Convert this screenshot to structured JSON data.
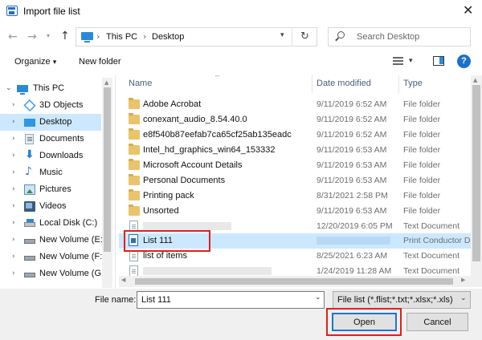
{
  "window": {
    "title": "Import file list"
  },
  "navigation": {
    "breadcrumb": [
      "This PC",
      "Desktop"
    ],
    "search_placeholder": "Search Desktop"
  },
  "toolbar": {
    "organize": "Organize",
    "new_folder": "New folder",
    "help": "?"
  },
  "sidebar": {
    "items": [
      {
        "label": "This PC",
        "icon": "computer-icon",
        "selected": false
      },
      {
        "label": "3D Objects",
        "icon": "cube-icon",
        "selected": false
      },
      {
        "label": "Desktop",
        "icon": "desktop-icon",
        "selected": true
      },
      {
        "label": "Documents",
        "icon": "document-icon",
        "selected": false
      },
      {
        "label": "Downloads",
        "icon": "download-icon",
        "selected": false
      },
      {
        "label": "Music",
        "icon": "music-icon",
        "selected": false
      },
      {
        "label": "Pictures",
        "icon": "picture-icon",
        "selected": false
      },
      {
        "label": "Videos",
        "icon": "video-icon",
        "selected": false
      },
      {
        "label": "Local Disk (C:)",
        "icon": "drive-icon",
        "selected": false
      },
      {
        "label": "New Volume (E:)",
        "icon": "drive-icon",
        "selected": false
      },
      {
        "label": "New Volume (F:)",
        "icon": "drive-icon",
        "selected": false
      },
      {
        "label": "New Volume (G:",
        "icon": "drive-icon",
        "selected": false
      }
    ]
  },
  "filelist": {
    "columns": [
      "Name",
      "Date modified",
      "Type"
    ],
    "rows": [
      {
        "name": "Adobe Acrobat",
        "date": "9/11/2019 6:52 AM",
        "type": "File folder",
        "icon": "folder-icon"
      },
      {
        "name": "conexant_audio_8.54.40.0",
        "date": "9/11/2019 6:52 AM",
        "type": "File folder",
        "icon": "folder-icon"
      },
      {
        "name": "e8f540b87eefab7ca65cf25ab135eadc",
        "date": "9/11/2019 6:52 AM",
        "type": "File folder",
        "icon": "folder-icon"
      },
      {
        "name": "Intel_hd_graphics_win64_153332",
        "date": "9/11/2019 6:53 AM",
        "type": "File folder",
        "icon": "folder-icon"
      },
      {
        "name": "Microsoft Account Details",
        "date": "9/11/2019 6:53 AM",
        "type": "File folder",
        "icon": "folder-icon"
      },
      {
        "name": "Personal Documents",
        "date": "9/11/2019 6:53 AM",
        "type": "File folder",
        "icon": "folder-icon"
      },
      {
        "name": "Printing pack",
        "date": "8/31/2021 2:58 PM",
        "type": "File folder",
        "icon": "folder-icon"
      },
      {
        "name": "Unsorted",
        "date": "9/11/2019 6:53 AM",
        "type": "File folder",
        "icon": "folder-icon"
      },
      {
        "name": "",
        "date": "12/20/2019 6:05 PM",
        "type": "Text Document",
        "icon": "text-file-icon"
      },
      {
        "name": "List 111",
        "date": "",
        "type": "Print Conductor D",
        "icon": "print-conductor-file-icon",
        "selected": true
      },
      {
        "name": "list of items",
        "date": "8/25/2021 6:23 AM",
        "type": "Text Document",
        "icon": "text-file-icon"
      },
      {
        "name": "",
        "date": "1/24/2019 11:28 AM",
        "type": "Text Document",
        "icon": "text-file-icon"
      }
    ]
  },
  "footer": {
    "filename_label": "File name:",
    "filename_value": "List 111",
    "filter": "File list (*.flist;*.txt;*.xlsx;*.xls)",
    "open": "Open",
    "cancel": "Cancel"
  },
  "colors": {
    "accent": "#1f6fc9",
    "selection": "#cce8ff",
    "highlight_box": "#e0201c",
    "folder": "#e9c46a"
  }
}
